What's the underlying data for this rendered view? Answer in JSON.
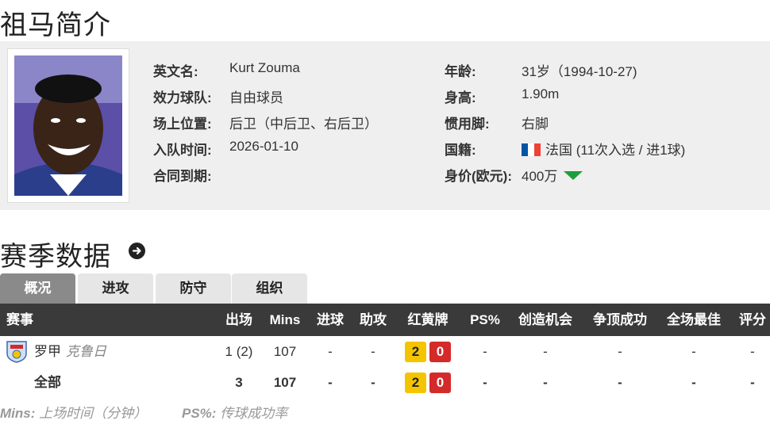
{
  "page_title": "祖马简介",
  "profile": {
    "left": [
      {
        "key": "英文名:",
        "value": "Kurt Zouma"
      },
      {
        "key": "效力球队:",
        "value": "自由球员"
      },
      {
        "key": "场上位置:",
        "value": "后卫（中后卫、右后卫）"
      },
      {
        "key": "入队时间:",
        "value": "2026-01-10"
      },
      {
        "key": "合同到期:",
        "value": ""
      }
    ],
    "right": [
      {
        "key": "年龄:",
        "value": "31岁（1994-10-27)"
      },
      {
        "key": "身高:",
        "value": "1.90m"
      },
      {
        "key": "惯用脚:",
        "value": "右脚"
      },
      {
        "key": "国籍:",
        "value": "法国 (11次入选 / 进1球)",
        "flag_icon": "france-flag-icon"
      },
      {
        "key": "身价(欧元):",
        "value": "400万",
        "trend_icon": "down-triangle-icon",
        "trend_color": "#1e9e3c"
      }
    ]
  },
  "section_title": "赛季数据",
  "tabs": [
    "概况",
    "进攻",
    "防守",
    "组织"
  ],
  "active_tab": 0,
  "table": {
    "headers": [
      "赛事",
      "出场",
      "Mins",
      "进球",
      "助攻",
      "红黄牌",
      "PS%",
      "创造机会",
      "争顶成功",
      "全场最佳",
      "评分"
    ],
    "rows": [
      {
        "league": "罗甲",
        "team": "克鲁日",
        "apps": "1 (2)",
        "mins": "107",
        "goals": "-",
        "assists": "-",
        "yellow": "2",
        "red": "0",
        "ps": "-",
        "chances": "-",
        "aerials": "-",
        "motm": "-",
        "rating": "-"
      },
      {
        "league": "全部",
        "team": "",
        "apps": "3",
        "mins": "107",
        "goals": "-",
        "assists": "-",
        "yellow": "2",
        "red": "0",
        "ps": "-",
        "chances": "-",
        "aerials": "-",
        "motm": "-",
        "rating": "-"
      }
    ]
  },
  "footnotes": [
    {
      "abbr": "Mins:",
      "text": "上场时间（分钟）"
    },
    {
      "abbr": "PS%:",
      "text": "传球成功率"
    }
  ],
  "colors": {
    "yellow_card": "#f5c400",
    "red_card": "#d42a2a",
    "header_bg": "#3a3a3a",
    "active_tab": "#8a8a8a"
  }
}
